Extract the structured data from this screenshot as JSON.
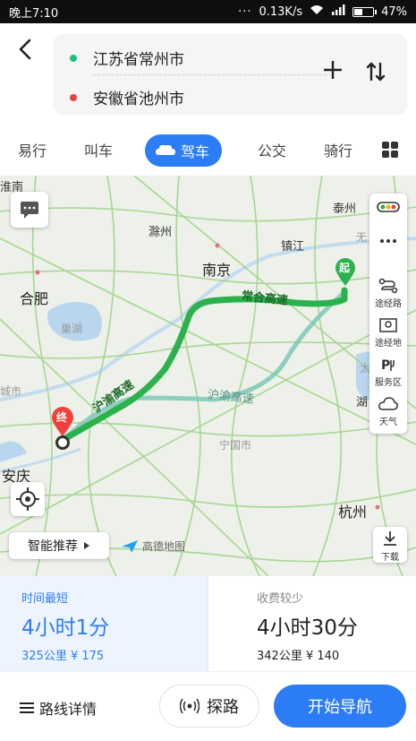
{
  "status_bar": {
    "time": "晚上7:10",
    "dots": "···",
    "network_speed": "0.13K/s",
    "battery": "47%",
    "battery_level": 0.47
  },
  "route": {
    "start": "江苏省常州市",
    "end": "安徽省池州市",
    "start_color": "#1ec27a",
    "end_color": "#f0413c"
  },
  "tabs": [
    {
      "label": "易行"
    },
    {
      "label": "叫车"
    },
    {
      "label": "驾车",
      "active": true
    },
    {
      "label": "公交"
    },
    {
      "label": "骑行"
    }
  ],
  "map": {
    "labels": {
      "huainan": "淮南",
      "taizhou": "泰州",
      "chuzhou": "滁州",
      "zhenjiang": "镇江",
      "nanjing": "南京",
      "hefei": "合肥",
      "chaohu": "巢湖",
      "city_partial": "城市",
      "anqing": "安庆",
      "ningguo": "宁国市",
      "hangzhou": "杭州",
      "hu_partial": "湖",
      "tai_partial": "太",
      "wu_partial": "无",
      "expressway_1": "常合高速",
      "expressway_2": "沪渝高速",
      "expressway_3": "沪渝高速"
    },
    "start_marker": "起",
    "end_marker": "终",
    "tools": {
      "via_route": "途经路",
      "via_place": "途经地",
      "service_area": "服务区",
      "weather": "天气"
    },
    "download": "下载",
    "smart_recommend": "智能推荐",
    "logo_text": "高德地图",
    "route_color": "#2bb24c",
    "alt_route_color": "#7cc8b6"
  },
  "options": [
    {
      "tag": "时间最短",
      "duration": "4小时1分",
      "meta": "325公里  ¥ 175"
    },
    {
      "tag": "收费较少",
      "duration": "4小时30分",
      "meta": "342公里  ¥ 140"
    }
  ],
  "bottom": {
    "detail": "路线详情",
    "explore": "探路",
    "start_nav": "开始导航",
    "accent": "#2c7cf6"
  }
}
